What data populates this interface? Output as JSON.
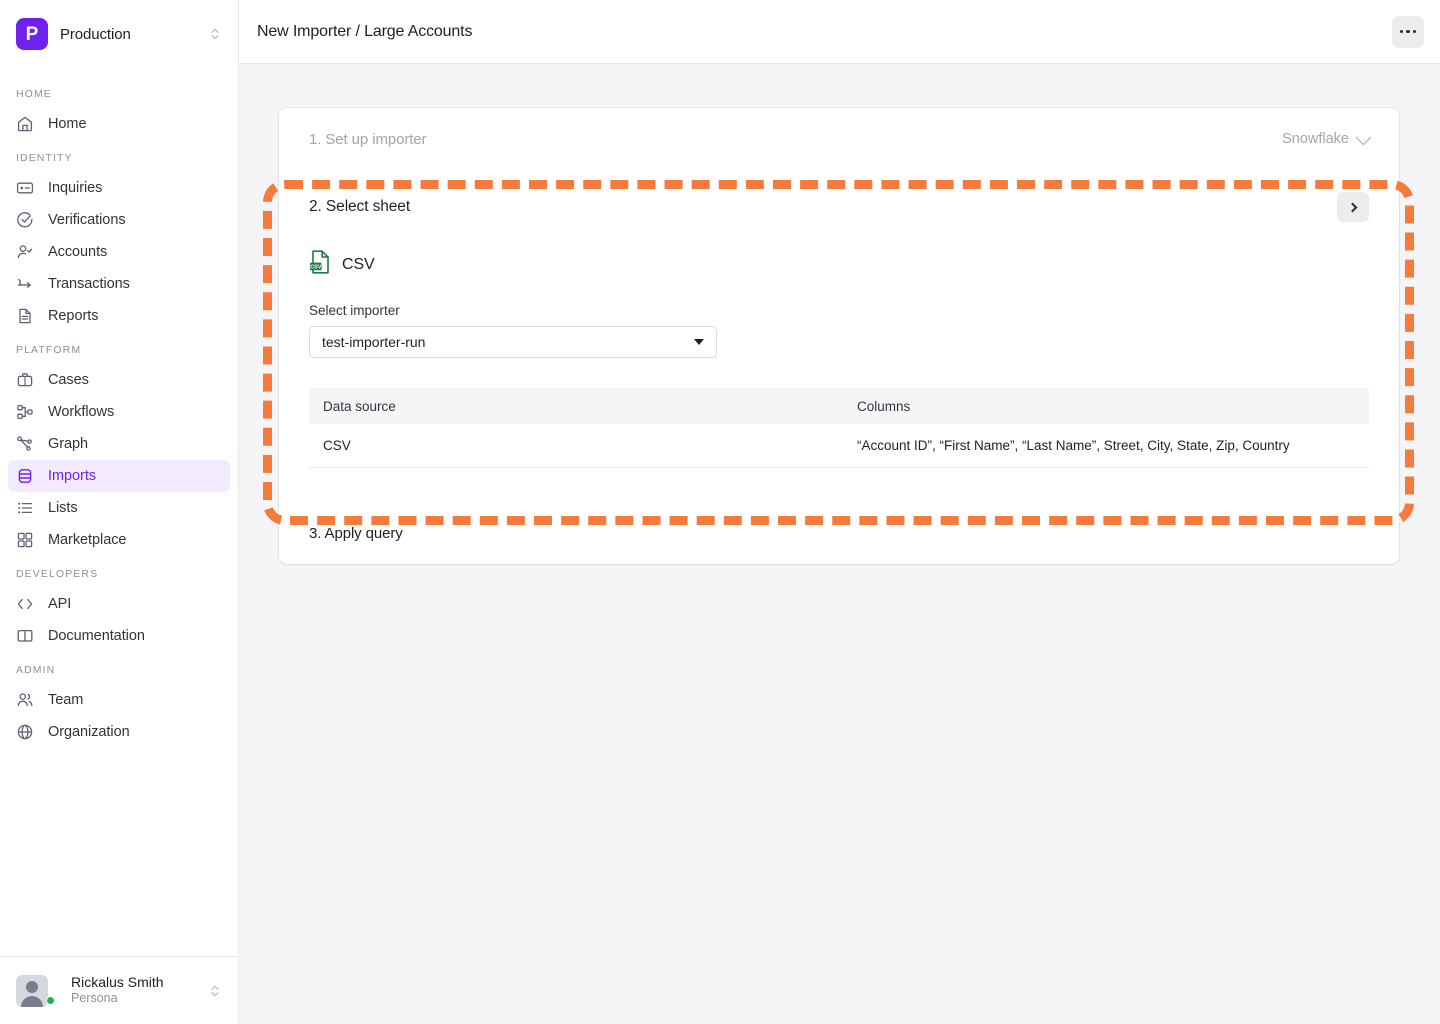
{
  "sidebar": {
    "org": {
      "logo_letter": "P",
      "name": "Production",
      "switch_icon": "chevron-up-down-icon"
    },
    "sections": [
      {
        "label": "HOME",
        "items": [
          {
            "label": "Home",
            "icon": "home-icon",
            "active": false
          }
        ]
      },
      {
        "label": "IDENTITY",
        "items": [
          {
            "label": "Inquiries",
            "icon": "id-card-icon",
            "active": false
          },
          {
            "label": "Verifications",
            "icon": "check-circle-icon",
            "active": false
          },
          {
            "label": "Accounts",
            "icon": "user-check-icon",
            "active": false
          },
          {
            "label": "Transactions",
            "icon": "transaction-arrow-icon",
            "active": false
          },
          {
            "label": "Reports",
            "icon": "document-icon",
            "active": false
          }
        ]
      },
      {
        "label": "PLATFORM",
        "items": [
          {
            "label": "Cases",
            "icon": "briefcase-icon",
            "active": false
          },
          {
            "label": "Workflows",
            "icon": "workflow-icon",
            "active": false
          },
          {
            "label": "Graph",
            "icon": "graph-node-icon",
            "active": false
          },
          {
            "label": "Imports",
            "icon": "database-icon",
            "active": true
          },
          {
            "label": "Lists",
            "icon": "list-icon",
            "active": false
          },
          {
            "label": "Marketplace",
            "icon": "grid-squares-icon",
            "active": false
          }
        ]
      },
      {
        "label": "DEVELOPERS",
        "items": [
          {
            "label": "API",
            "icon": "code-brackets-icon",
            "active": false
          },
          {
            "label": "Documentation",
            "icon": "book-icon",
            "active": false
          }
        ]
      },
      {
        "label": "ADMIN",
        "items": [
          {
            "label": "Team",
            "icon": "users-icon",
            "active": false
          },
          {
            "label": "Organization",
            "icon": "globe-icon",
            "active": false
          }
        ]
      }
    ],
    "user": {
      "name": "Rickalus Smith",
      "org": "Persona",
      "status": "online",
      "switch_icon": "chevron-up-down-icon"
    }
  },
  "topbar": {
    "title": "New Importer / Large Accounts",
    "more_icon": "ellipsis-icon"
  },
  "stepper": {
    "step1": {
      "label": "1. Set up importer",
      "source_value": "Snowflake",
      "caret_icon": "chevron-down-icon"
    },
    "step2": {
      "label": "2. Select sheet",
      "next_icon": "chevron-right-icon",
      "source_icon": "csv-file-icon",
      "source_badge": "CSV",
      "source_name": "CSV",
      "field_label": "Select importer",
      "field_value": "test-importer-run",
      "select_caret_icon": "caret-down-icon",
      "table": {
        "headers": [
          "Data source",
          "Columns"
        ],
        "rows": [
          [
            "CSV",
            "“Account ID”, “First Name”, “Last Name”, Street, City, State, Zip, Country"
          ]
        ]
      }
    },
    "step3": {
      "label": "3. Apply query"
    }
  },
  "colors": {
    "brand_purple": "#7021F0",
    "active_bg": "#f1ebfd",
    "annotation_orange": "#F57B3C",
    "csv_green": "#1E7A45",
    "page_bg": "#f5f5f7"
  }
}
